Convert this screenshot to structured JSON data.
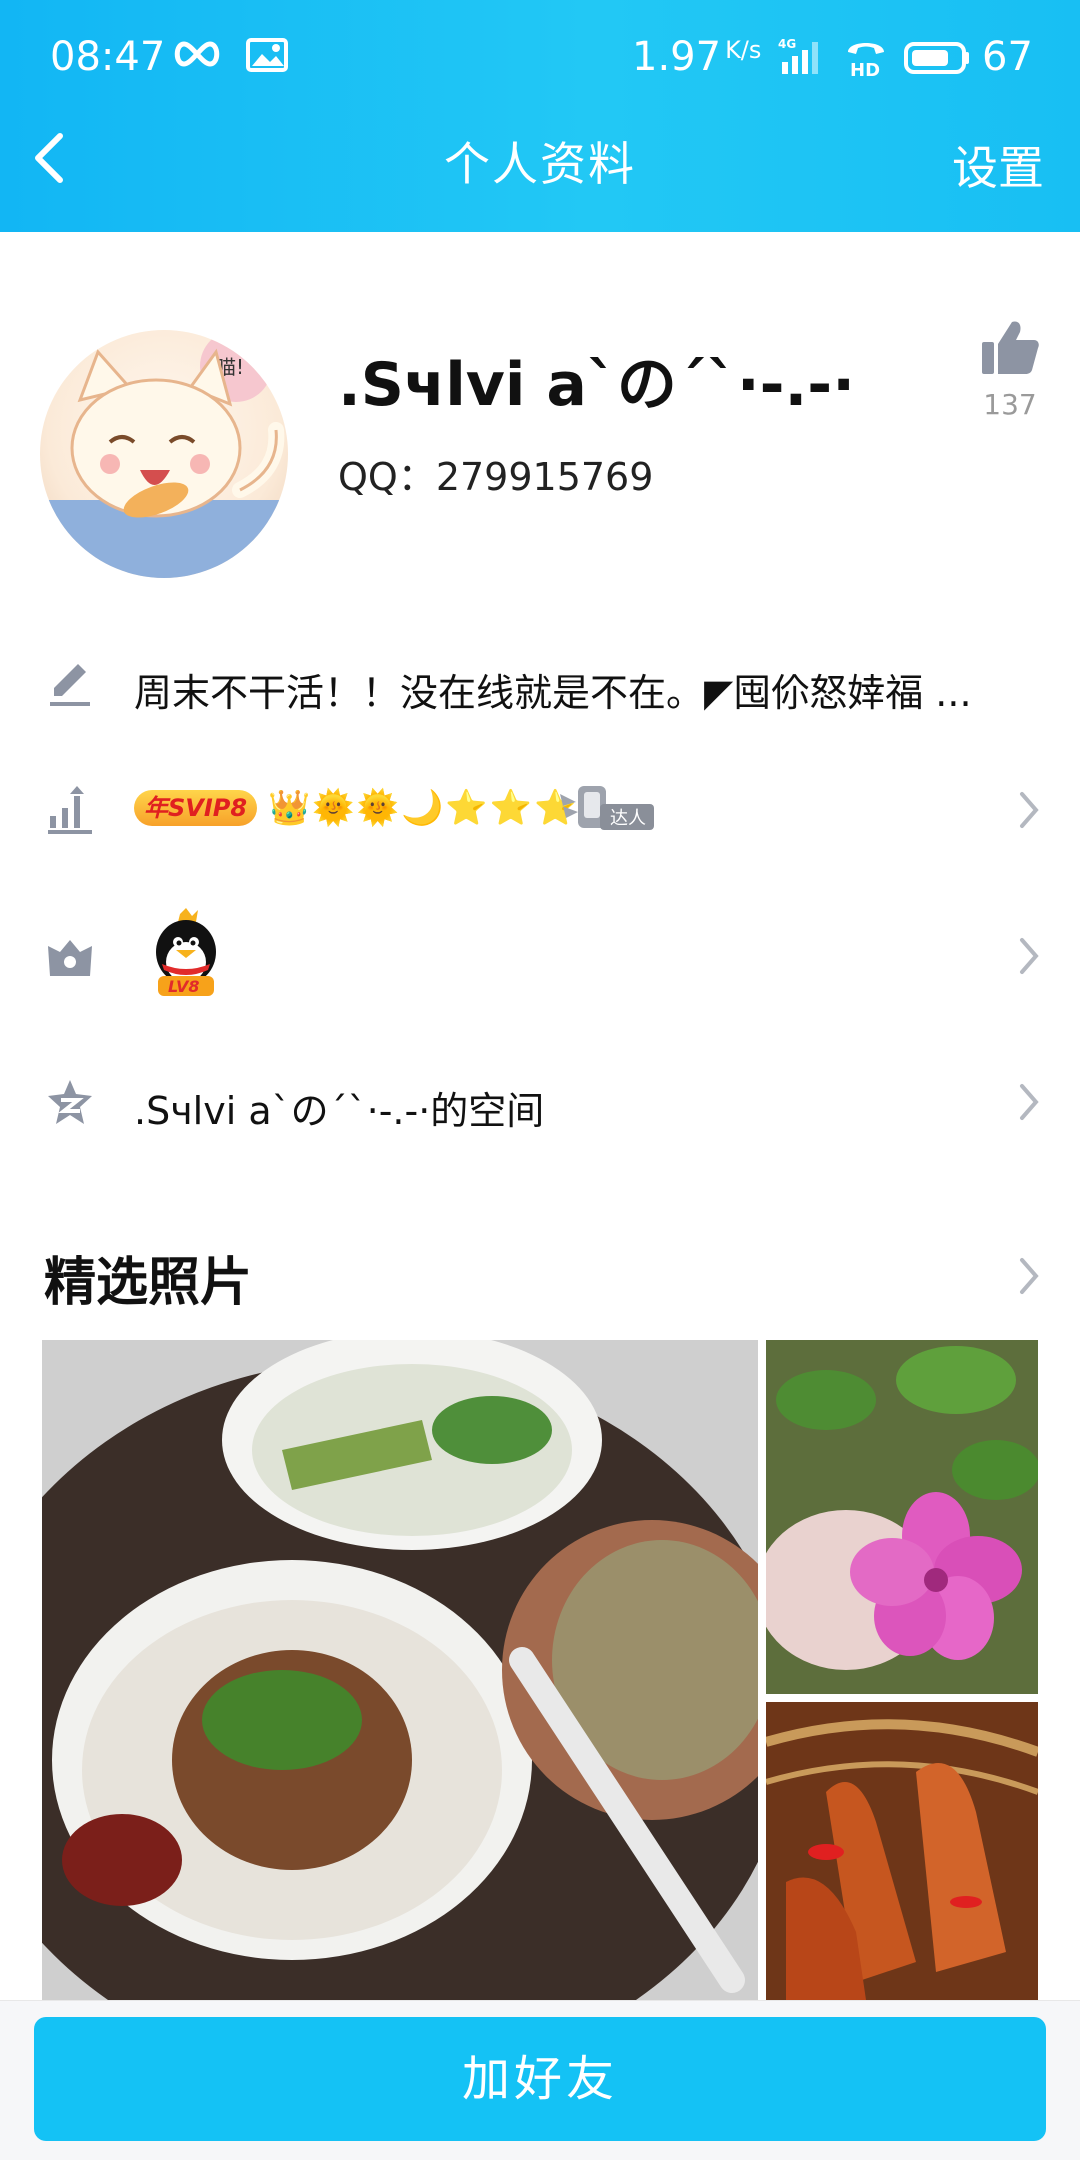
{
  "status_bar": {
    "time": "08:47",
    "net_speed": "1.97",
    "net_unit": "K/s",
    "battery_level": "67"
  },
  "nav": {
    "title": "个人资料",
    "settings_label": "设置"
  },
  "profile": {
    "avatar_text": "喵!",
    "name": ".Sчlvi a`の´`·-.-·",
    "qq": "QQ：279915769",
    "likes": "137"
  },
  "rows": {
    "signature": "周末不干活！！没在线就是不在。◤囤伱怒婞福 ...",
    "svip_badge": "年SVIP8",
    "daren_label": "达人",
    "pet_level": "LV8",
    "space": ".Sчlvi a`の´`·-.-·的空间"
  },
  "photos": {
    "section_title": "精选照片"
  },
  "bottom": {
    "add_friend_label": "加好友"
  },
  "colors": {
    "header": "#18bff3",
    "button": "#14c2f5",
    "icon_gray": "#8d94a3"
  }
}
